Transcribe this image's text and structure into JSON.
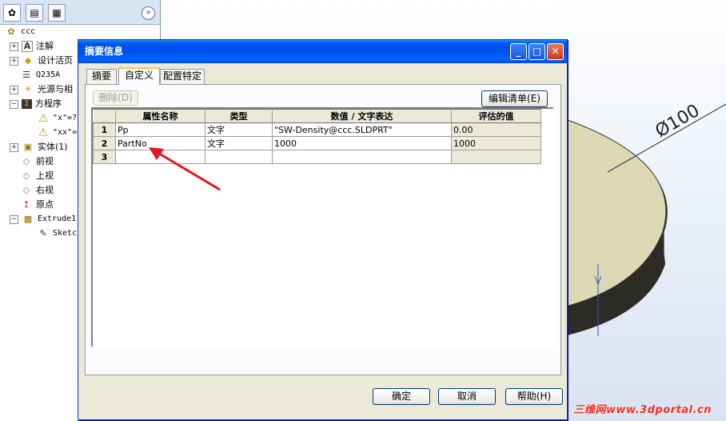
{
  "tree": {
    "tab_icons": [
      "feature-tree-icon",
      "property-manager-icon",
      "configuration-manager-icon"
    ],
    "collapse_glyph": "»",
    "nodes": [
      {
        "label": "ccc",
        "icon": "part-icon",
        "expander": ""
      },
      {
        "label": "注解",
        "icon": "annotation-icon",
        "expander": "+"
      },
      {
        "label": "设计活页",
        "icon": "design-binder-icon",
        "expander": "+"
      },
      {
        "label": "Q235A",
        "icon": "material-icon",
        "expander": ""
      },
      {
        "label": "光源与相",
        "icon": "lights-icon",
        "expander": "+"
      },
      {
        "label": "方程序",
        "icon": "equations-icon",
        "expander": "−"
      },
      {
        "label": "\"x\"=?",
        "icon": "equation-warning-icon",
        "expander": ""
      },
      {
        "label": "\"xx\"=",
        "icon": "equation-warning-icon",
        "expander": ""
      },
      {
        "label": "实体(1)",
        "icon": "solid-bodies-icon",
        "expander": "+"
      },
      {
        "label": "前视",
        "icon": "plane-icon",
        "expander": ""
      },
      {
        "label": "上视",
        "icon": "plane-icon",
        "expander": ""
      },
      {
        "label": "右视",
        "icon": "plane-icon",
        "expander": ""
      },
      {
        "label": "原点",
        "icon": "origin-icon",
        "expander": ""
      },
      {
        "label": "Extrude1",
        "icon": "extrude-icon",
        "expander": "−"
      },
      {
        "label": "Sketc",
        "icon": "sketch-icon",
        "expander": ""
      }
    ]
  },
  "dialog": {
    "title": "摘要信息",
    "title_buttons": {
      "minimize": "_",
      "maximize": "□",
      "close": "✕"
    },
    "tabs": [
      {
        "label": "摘要",
        "active": false
      },
      {
        "label": "自定义",
        "active": true
      },
      {
        "label": "配置特定",
        "active": false
      }
    ],
    "delete_button": "删除(D)",
    "edit_list_button": "编辑清单(E)",
    "table": {
      "columns": [
        "属性名称",
        "类型",
        "数值 / 文字表达",
        "评估的值"
      ],
      "rows": [
        {
          "num": "1",
          "name": "Pp",
          "type": "文字",
          "value": "\"SW-Density@ccc.SLDPRT\"",
          "evaluated": "0.00"
        },
        {
          "num": "2",
          "name": "PartNo",
          "type": "文字",
          "value": "1000",
          "evaluated": "1000"
        },
        {
          "num": "3",
          "name": "",
          "type": "",
          "value": "",
          "evaluated": ""
        }
      ]
    },
    "ok_button": "确定",
    "cancel_button": "取消",
    "help_button": "帮助(H)"
  },
  "viewport": {
    "dimension_label": "Ø100",
    "part_color": "#dcd9b4"
  },
  "annotation": {
    "arrow_color": "#e8141e"
  },
  "watermark": "三维网www.3dportal.cn"
}
